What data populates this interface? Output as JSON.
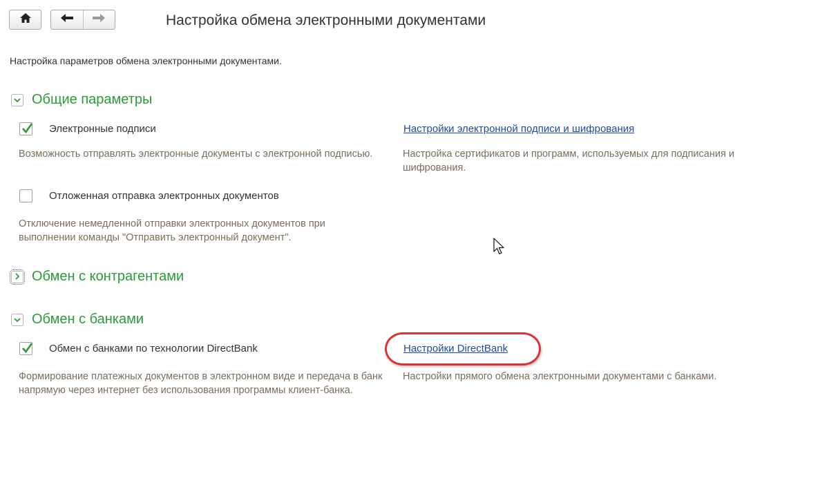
{
  "window": {
    "title": "Настройка обмена электронными документами",
    "description": "Настройка параметров обмена электронными документами."
  },
  "toolbar": {
    "home_icon": "home-icon",
    "back_icon": "arrow-left-icon",
    "forward_icon": "arrow-right-icon"
  },
  "sections": {
    "general": {
      "title": "Общие параметры",
      "expanded": true,
      "signatures": {
        "label": "Электронные подписи",
        "checked": true,
        "note": "Возможность отправлять электронные документы с электронной подписью.",
        "link": "Настройки электронной подписи и шифрования",
        "link_note": "Настройка сертификатов и программ, используемых для подписания и шифрования."
      },
      "deferred": {
        "label": "Отложенная отправка электронных документов",
        "checked": false,
        "note": "Отключение немедленной отправки электронных документов при выполнении команды \"Отправить электронный документ\"."
      }
    },
    "counterparties": {
      "title": "Обмен с контрагентами",
      "expanded": false
    },
    "banks": {
      "title": "Обмен с банками",
      "expanded": true,
      "directbank": {
        "label": "Обмен с банками по технологии DirectBank",
        "checked": true,
        "note": "Формирование платежных документов в электронном виде и передача в банк напрямую через интернет без использования программы клиент-банка.",
        "link": "Настройки DirectBank",
        "link_note": "Настройки прямого обмена электронными документами с банками."
      }
    }
  },
  "colors": {
    "section_title": "#2a9a3a",
    "link": "#1f4aa8",
    "note": "#7a6d5a",
    "highlight": "#d93434",
    "check": "#2a9a3a"
  }
}
